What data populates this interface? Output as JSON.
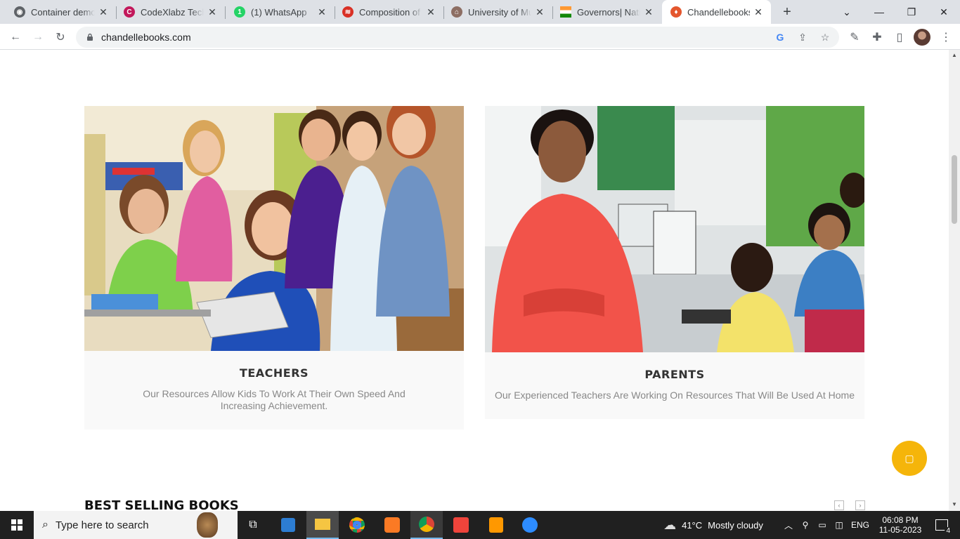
{
  "browser": {
    "tabs": [
      {
        "title": "Container demo",
        "favicon_color": "#5f6368",
        "favicon_glyph": "◉"
      },
      {
        "title": "CodeXlabz Technologies",
        "favicon_color": "#c2185b",
        "favicon_glyph": "C"
      },
      {
        "title": "(1) WhatsApp",
        "favicon_color": "#25d366",
        "favicon_glyph": "1"
      },
      {
        "title": "Composition of Union",
        "favicon_color": "#d93025",
        "favicon_glyph": "≋"
      },
      {
        "title": "University of Mumbai",
        "favicon_color": "#8d6e63",
        "favicon_glyph": "⌂"
      },
      {
        "title": "Governors| National Portal",
        "favicon_color": "#ff9933",
        "favicon_glyph": "▬"
      },
      {
        "title": "Chandellebooks",
        "favicon_color": "#e4572e",
        "favicon_glyph": "♦"
      }
    ],
    "url": "chandellebooks.com"
  },
  "page": {
    "cards": [
      {
        "heading": "TEACHERS",
        "description": "Our Resources Allow Kids To Work At Their Own Speed And Increasing Achievement."
      },
      {
        "heading": "PARENTS",
        "description": "Our Experienced Teachers Are Working On Resources That Will Be Used At Home"
      }
    ],
    "section_title": "BEST SELLING BOOKS",
    "accent_color": "#f5b50a"
  },
  "taskbar": {
    "search_placeholder": "Type here to search",
    "weather_temp": "41°C",
    "weather_desc": "Mostly cloudy",
    "language": "ENG",
    "time": "06:08 PM",
    "date": "11-05-2023",
    "notification_count": "4"
  }
}
